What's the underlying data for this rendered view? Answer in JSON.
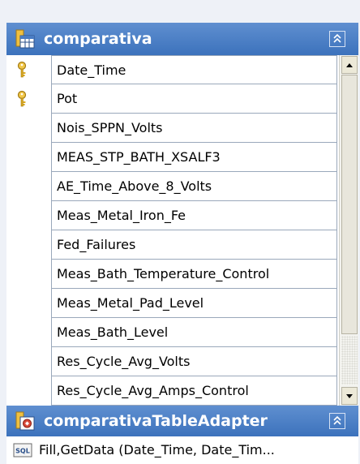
{
  "table": {
    "title": "comparativa",
    "icon": "table-icon",
    "collapse_icon": "collapse-up-chevron-icon",
    "rows": [
      {
        "label": "Date_Time",
        "primary_key": true
      },
      {
        "label": "Pot",
        "primary_key": true
      },
      {
        "label": "Nois_SPPN_Volts",
        "primary_key": false
      },
      {
        "label": "MEAS_STP_BATH_XSALF3",
        "primary_key": false
      },
      {
        "label": "AE_Time_Above_8_Volts",
        "primary_key": false
      },
      {
        "label": "Meas_Metal_Iron_Fe",
        "primary_key": false
      },
      {
        "label": "Fed_Failures",
        "primary_key": false
      },
      {
        "label": "Meas_Bath_Temperature_Control",
        "primary_key": false
      },
      {
        "label": "Meas_Metal_Pad_Level",
        "primary_key": false
      },
      {
        "label": "Meas_Bath_Level",
        "primary_key": false
      },
      {
        "label": "Res_Cycle_Avg_Volts",
        "primary_key": false
      },
      {
        "label": "Res_Cycle_Avg_Amps_Control",
        "primary_key": false
      }
    ]
  },
  "adapter": {
    "title": "comparativaTableAdapter",
    "icon": "table-adapter-icon",
    "collapse_icon": "collapse-up-chevron-icon",
    "method_icon": "sql-icon",
    "method_label": "Fill,GetData (Date_Time, Date_Tim..."
  },
  "colors": {
    "header_blue": "#3c72bc",
    "border_blue": "#2e6bb5",
    "row_border": "#9aa8bb",
    "key_gold": "#e8b530"
  }
}
